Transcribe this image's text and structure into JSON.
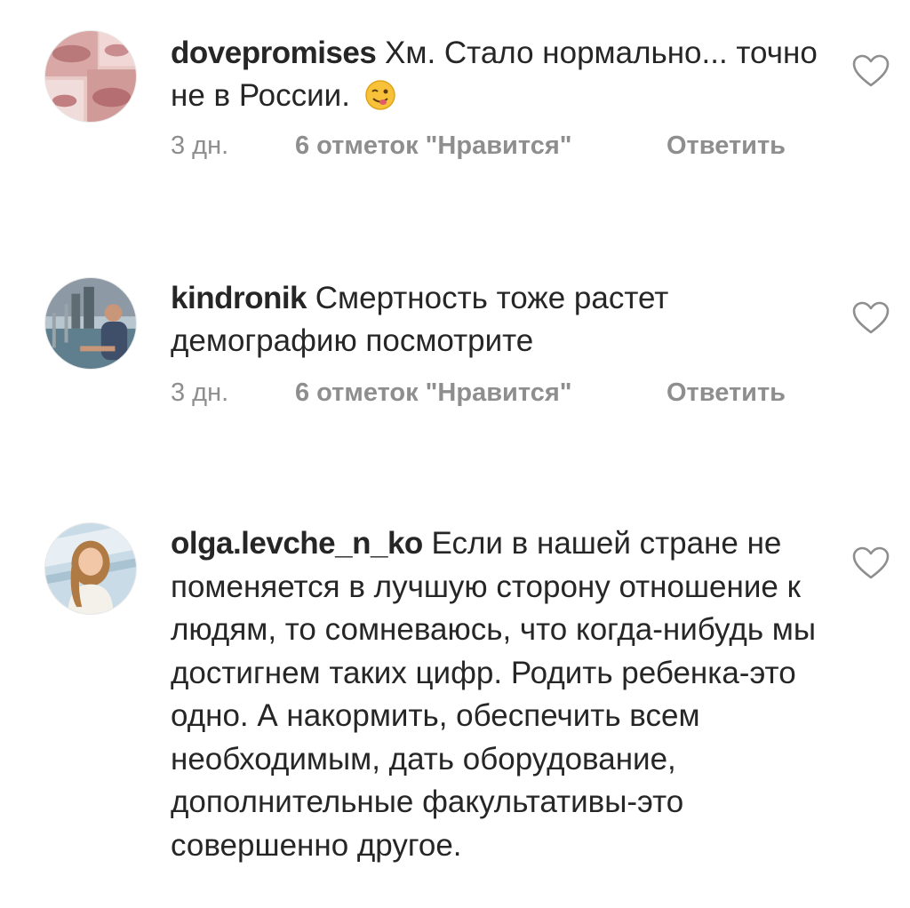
{
  "comments": [
    {
      "username": "dovepromises",
      "text": "Хм. Стало нормально... точно не в России.",
      "emoji": "winking-face-with-tongue",
      "time": "3 дн.",
      "likes": "6 отметок \"Нравится\"",
      "reply": "Ответить",
      "avatar": "lips-collage"
    },
    {
      "username": "kindronik",
      "text": "Смертность тоже растет демографию  посмотрите",
      "time": "3 дн.",
      "likes": "6 отметок \"Нравится\"",
      "reply": "Ответить",
      "avatar": "man-by-water"
    },
    {
      "username": "olga.levche_n_ko",
      "text": "Если в нашей стране не поменяется в лучшую сторону отношение к людям, то сомневаюсь, что когда-нибудь мы достигнем таких цифр. Родить ребенка-это одно. А накормить, обеспечить всем необходимым, дать оборудование, дополнительные факультативы-это совершенно другое.",
      "avatar": "woman-portrait"
    }
  ],
  "icons": {
    "like": "heart-outline-icon"
  },
  "colors": {
    "text": "#262626",
    "secondary": "#8e8e8e",
    "background": "#ffffff"
  }
}
